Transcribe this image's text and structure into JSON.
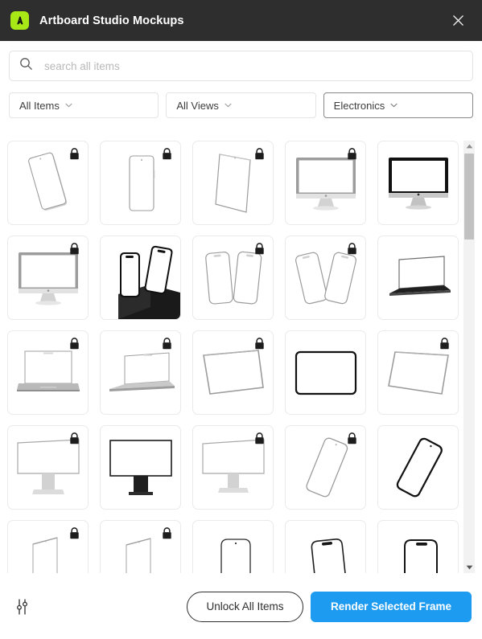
{
  "titlebar": {
    "logo_icon": "artboard-studio-logo",
    "logo_color": "#a8e816",
    "title": "Artboard Studio Mockups",
    "close_icon": "close-icon",
    "background": "#2e2e2e"
  },
  "search": {
    "icon": "search-icon",
    "placeholder": "search all items",
    "value": ""
  },
  "filters": [
    {
      "label": "All Items",
      "icon": "chevron-down-icon",
      "active": false
    },
    {
      "label": "All Views",
      "icon": "chevron-down-icon",
      "active": false
    },
    {
      "label": "Electronics",
      "icon": "chevron-down-icon",
      "active": true
    }
  ],
  "grid": {
    "columns": 5,
    "lock_icon": "lock-icon",
    "items": [
      {
        "kind": "phone-tilted-light",
        "locked": true
      },
      {
        "kind": "phone-front-light",
        "locked": true
      },
      {
        "kind": "phone-angled-light",
        "locked": true
      },
      {
        "kind": "imac-light",
        "locked": true
      },
      {
        "kind": "imac-dark",
        "locked": false
      },
      {
        "kind": "imac-light",
        "locked": true
      },
      {
        "kind": "phones-pedestal-dark",
        "locked": false
      },
      {
        "kind": "two-phones-outline",
        "locked": true
      },
      {
        "kind": "two-phones-angled",
        "locked": true
      },
      {
        "kind": "laptop-open-dark",
        "locked": false
      },
      {
        "kind": "laptop-front-light",
        "locked": true
      },
      {
        "kind": "laptop-angled-light",
        "locked": true
      },
      {
        "kind": "tablet-tilted-light",
        "locked": true
      },
      {
        "kind": "tablet-front-dark",
        "locked": false
      },
      {
        "kind": "tablet-angled-light",
        "locked": true
      },
      {
        "kind": "monitor-light",
        "locked": true
      },
      {
        "kind": "monitor-dark",
        "locked": false
      },
      {
        "kind": "monitor-light-2",
        "locked": true
      },
      {
        "kind": "phone-diagonal-light",
        "locked": true
      },
      {
        "kind": "phone-diagonal-dark",
        "locked": false
      },
      {
        "kind": "phone-edge-light",
        "locked": true
      },
      {
        "kind": "phone-edge-light-2",
        "locked": true
      },
      {
        "kind": "phone-top-light",
        "locked": false
      },
      {
        "kind": "phone-top-notch",
        "locked": false
      },
      {
        "kind": "phone-top-dark",
        "locked": false
      }
    ]
  },
  "scrollbar": {
    "up_icon": "scroll-up-arrow-icon",
    "down_icon": "scroll-down-arrow-icon",
    "thumb_position": "top"
  },
  "footer": {
    "settings_icon": "sliders-settings-icon",
    "unlock_label": "Unlock All Items",
    "render_label": "Render Selected Frame",
    "render_color": "#1d9bf0"
  }
}
